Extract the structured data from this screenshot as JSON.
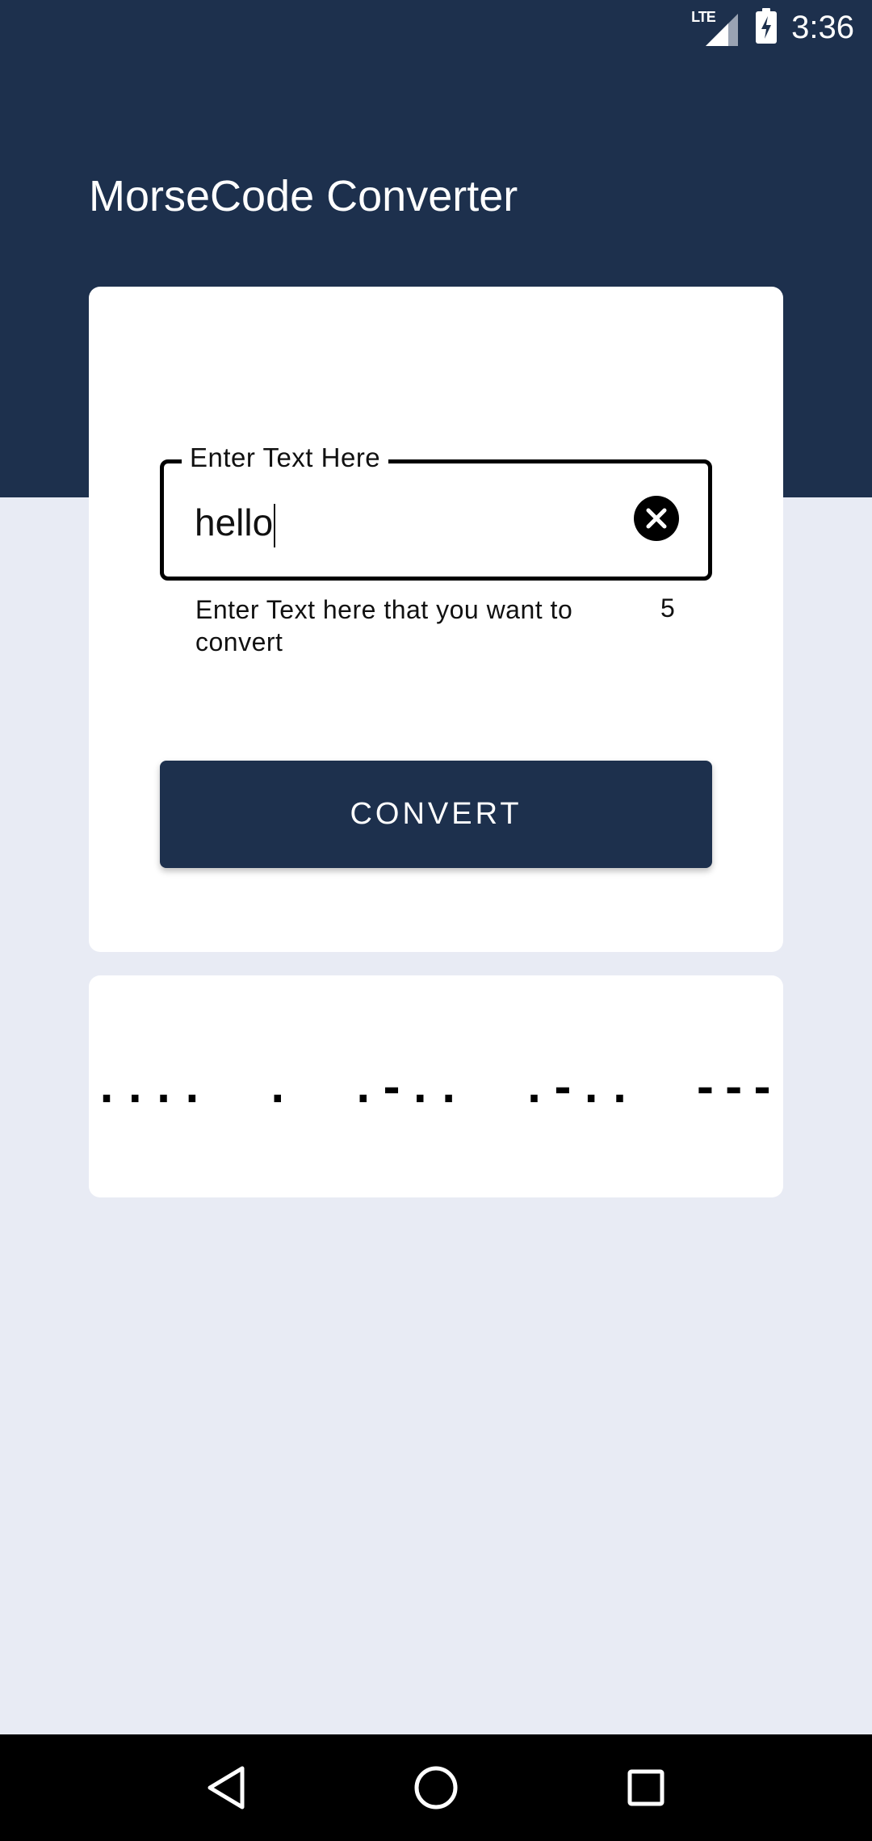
{
  "status_bar": {
    "network": "LTE",
    "time": "3:36"
  },
  "app": {
    "title": "MorseCode Converter"
  },
  "input": {
    "label": "Enter Text Here",
    "value": "hello",
    "helper": "Enter Text here that you want to convert",
    "char_count": "5"
  },
  "convert_button": {
    "label": "CONVERT"
  },
  "output": {
    "morse": "....  .  .-..  .-..  ---"
  },
  "nav": {
    "icons": [
      "back-icon",
      "home-icon",
      "recents-icon"
    ]
  },
  "colors": {
    "primary": "#1d304d",
    "background": "#e8ebf4",
    "card": "#ffffff"
  }
}
